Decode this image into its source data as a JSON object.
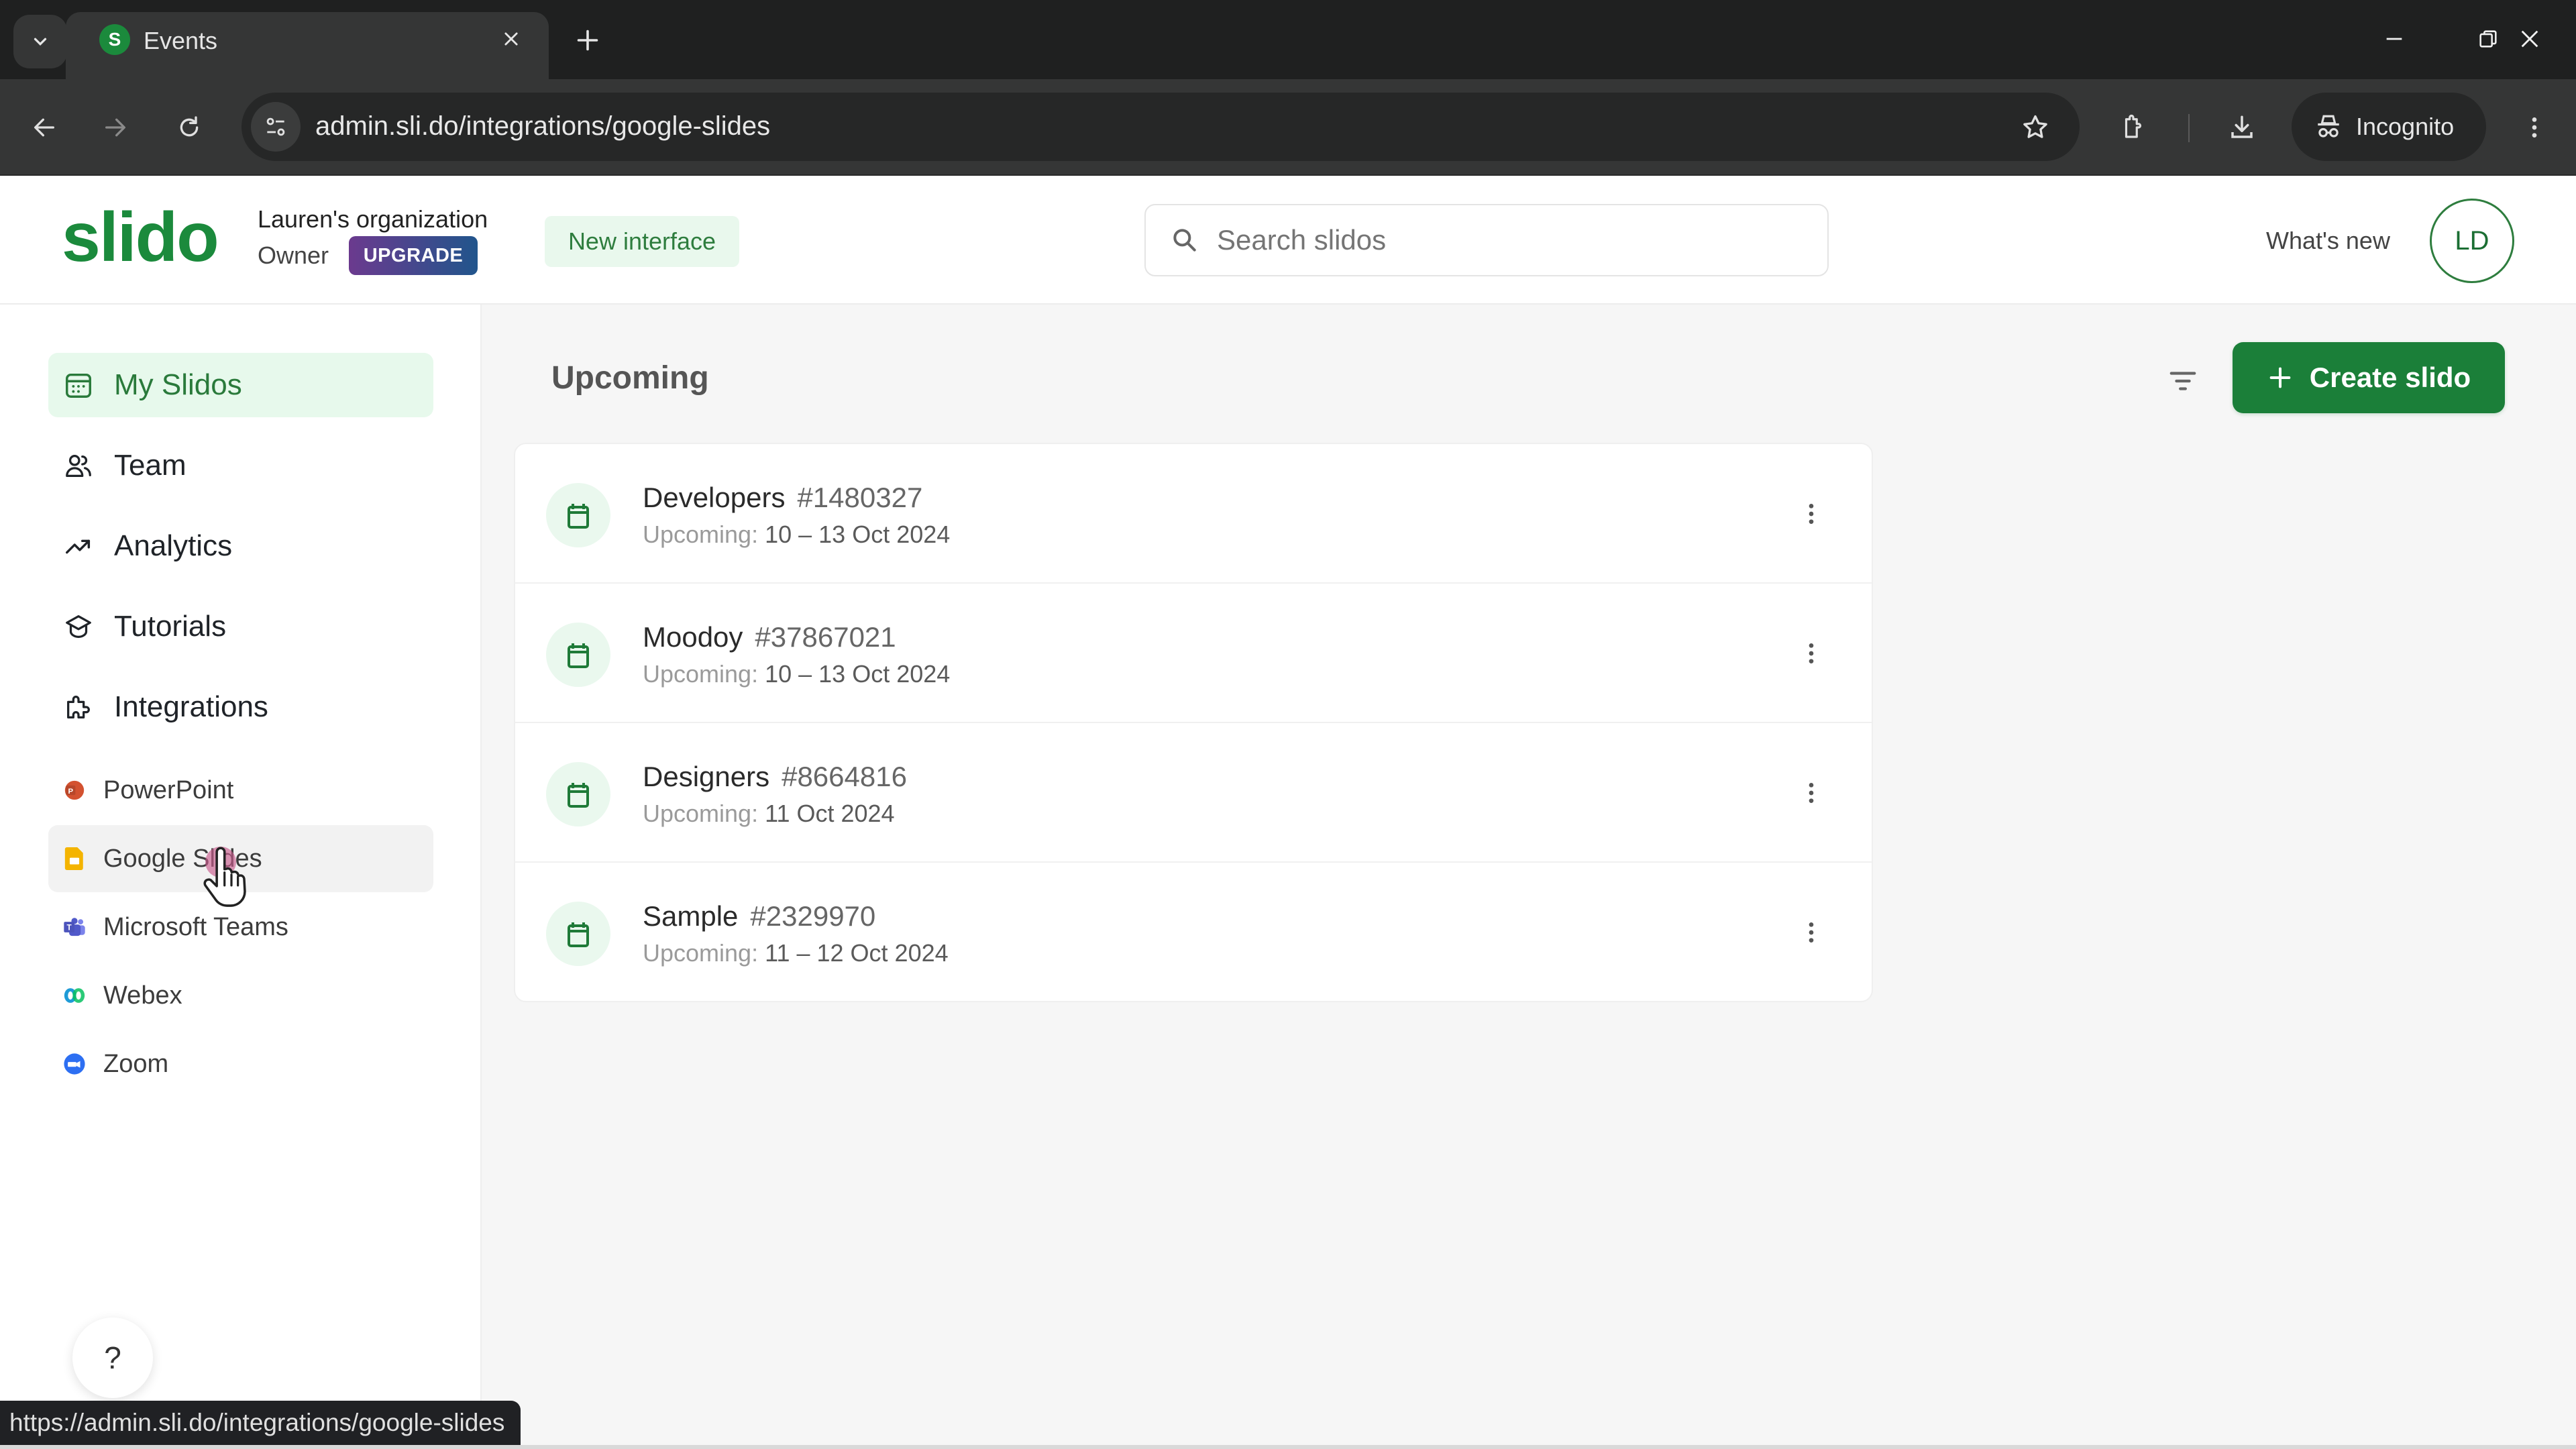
{
  "browser": {
    "tab_title": "Events",
    "tab_favicon_letter": "S",
    "url": "admin.sli.do/integrations/google-slides",
    "incognito_label": "Incognito",
    "status_url": "https://admin.sli.do/integrations/google-slides"
  },
  "header": {
    "logo": "slido",
    "org_name": "Lauren's organization",
    "role": "Owner",
    "upgrade_label": "UPGRADE",
    "new_interface_label": "New interface",
    "search_placeholder": "Search slidos",
    "search_value": "",
    "whats_new_label": "What's new",
    "avatar_initials": "LD"
  },
  "sidebar": {
    "nav": [
      {
        "label": "My Slidos",
        "icon": "calendar-grid-icon",
        "active": true
      },
      {
        "label": "Team",
        "icon": "team-icon"
      },
      {
        "label": "Analytics",
        "icon": "trend-up-icon"
      },
      {
        "label": "Tutorials",
        "icon": "graduation-cap-icon"
      },
      {
        "label": "Integrations",
        "icon": "puzzle-icon"
      }
    ],
    "integrations": [
      {
        "label": "PowerPoint",
        "icon": "powerpoint-icon",
        "color": "#d35230"
      },
      {
        "label": "Google Slides",
        "icon": "google-slides-icon",
        "color": "#f4b400",
        "hovered": true
      },
      {
        "label": "Microsoft Teams",
        "icon": "microsoft-teams-icon",
        "color": "#5059c9"
      },
      {
        "label": "Webex",
        "icon": "webex-icon",
        "color": "#1f9bd7"
      },
      {
        "label": "Zoom",
        "icon": "zoom-icon",
        "color": "#2d6ff2"
      }
    ],
    "help_label": "?"
  },
  "main": {
    "section_title": "Upcoming",
    "create_label": "Create slido",
    "events": [
      {
        "name": "Developers",
        "code": "#1480327",
        "status": "Upcoming:",
        "dates": "10 – 13 Oct 2024"
      },
      {
        "name": "Moodoy",
        "code": "#37867021",
        "status": "Upcoming:",
        "dates": "10 – 13 Oct 2024"
      },
      {
        "name": "Designers",
        "code": "#8664816",
        "status": "Upcoming:",
        "dates": "11 Oct 2024"
      },
      {
        "name": "Sample",
        "code": "#2329970",
        "status": "Upcoming:",
        "dates": "11 – 12 Oct 2024"
      }
    ]
  },
  "colors": {
    "brand_green": "#1b8a3c",
    "button_green": "#1b7f39",
    "active_nav_bg": "#e7f9ec"
  }
}
